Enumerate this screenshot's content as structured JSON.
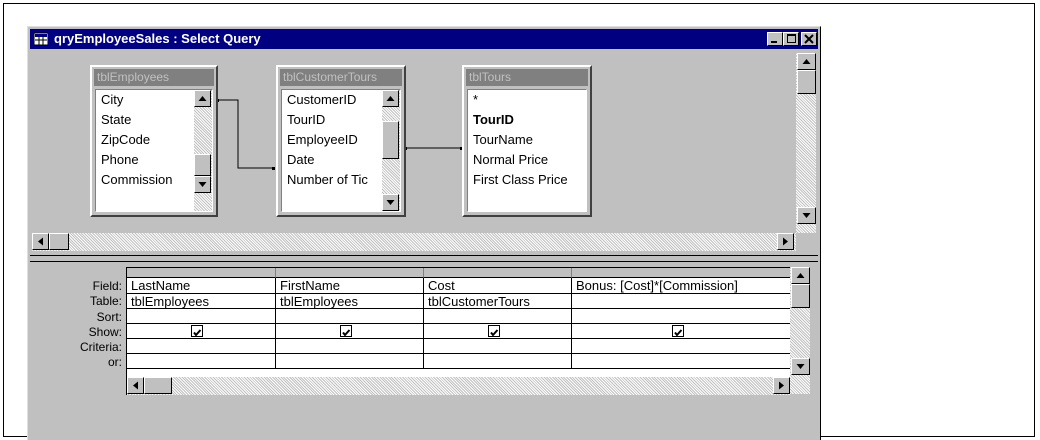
{
  "window": {
    "title": "qryEmployeeSales : Select Query"
  },
  "tables": [
    {
      "name": "tblEmployees",
      "fields": [
        "City",
        "State",
        "ZipCode",
        "Phone",
        "Commission"
      ]
    },
    {
      "name": "tblCustomerTours",
      "fields": [
        "CustomerID",
        "TourID",
        "EmployeeID",
        "Date",
        "Number of Tic"
      ]
    },
    {
      "name": "tblTours",
      "fields": [
        "*",
        "TourID",
        "TourName",
        "Normal Price",
        "First Class Price"
      ]
    }
  ],
  "grid": {
    "row_labels": [
      "Field:",
      "Table:",
      "Sort:",
      "Show:",
      "Criteria:",
      "or:"
    ],
    "columns": [
      {
        "field": "LastName",
        "table": "tblEmployees",
        "show": true
      },
      {
        "field": "FirstName",
        "table": "tblEmployees",
        "show": true
      },
      {
        "field": "Cost",
        "table": "tblCustomerTours",
        "show": true
      },
      {
        "field": "Bonus: [Cost]*[Commission]",
        "table": "",
        "show": true
      }
    ]
  }
}
